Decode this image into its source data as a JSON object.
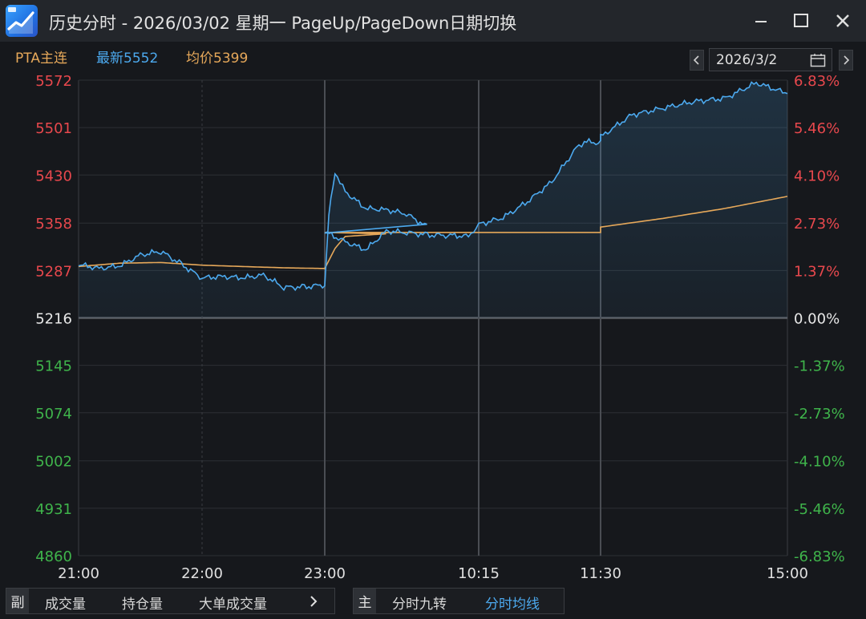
{
  "window": {
    "title": "历史分时 - 2026/03/02 星期一 PageUp/PageDown日期切换",
    "icon": "app-chart-icon"
  },
  "info": {
    "symbol": "PTA主连",
    "latest": "最新5552",
    "average": "均价5399",
    "date": "2026/3/2"
  },
  "colors": {
    "up": "#e8484d",
    "down": "#3fb44b",
    "price_line": "#4ca9ee",
    "avg_line": "#e6a85a",
    "grid": "#3a3d42"
  },
  "chart_data": {
    "type": "line",
    "base_price": 5216,
    "y_ticks_left": [
      "5572",
      "5501",
      "5430",
      "5358",
      "5287",
      "5216",
      "5145",
      "5074",
      "5002",
      "4931",
      "4860"
    ],
    "y_ticks_right": [
      "6.83%",
      "5.46%",
      "4.10%",
      "2.73%",
      "1.37%",
      "0.00%",
      "-1.37%",
      "-2.73%",
      "-4.10%",
      "-5.46%",
      "-6.83%"
    ],
    "ylim": [
      4860,
      5572
    ],
    "x_ticks": [
      "21:00",
      "22:00",
      "23:00",
      "10:15",
      "11:30",
      "15:00"
    ],
    "series": [
      {
        "name": "最新",
        "x": [
          "21:00",
          "21:10",
          "21:20",
          "21:30",
          "21:40",
          "21:50",
          "22:00",
          "22:10",
          "22:20",
          "22:30",
          "22:40",
          "22:50",
          "23:00",
          "23:02",
          "23:05",
          "23:10",
          "23:20",
          "23:30",
          "23:40",
          "23:50",
          "09:00",
          "09:10",
          "09:20",
          "09:30",
          "09:40",
          "09:50",
          "10:00",
          "10:10",
          "10:15",
          "10:30",
          "10:45",
          "11:00",
          "11:15",
          "11:20",
          "11:30",
          "13:30",
          "13:45",
          "14:00",
          "14:15",
          "14:30",
          "14:45",
          "15:00"
        ],
        "values": [
          5296,
          5290,
          5294,
          5310,
          5316,
          5296,
          5276,
          5278,
          5276,
          5280,
          5262,
          5262,
          5266,
          5370,
          5435,
          5405,
          5380,
          5378,
          5372,
          5352,
          5345,
          5330,
          5318,
          5346,
          5344,
          5340,
          5340,
          5338,
          5356,
          5366,
          5390,
          5420,
          5470,
          5480,
          5478,
          5487,
          5520,
          5530,
          5540,
          5545,
          5568,
          5552
        ]
      },
      {
        "name": "均价",
        "x": [
          "21:00",
          "21:20",
          "21:40",
          "22:00",
          "22:20",
          "22:40",
          "23:00",
          "23:05",
          "23:10",
          "23:30",
          "09:00",
          "10:00",
          "10:15",
          "11:00",
          "11:30",
          "13:30",
          "14:00",
          "14:30",
          "15:00"
        ],
        "values": [
          5293,
          5298,
          5299,
          5295,
          5293,
          5291,
          5290,
          5320,
          5338,
          5342,
          5344,
          5344,
          5344,
          5344,
          5344,
          5352,
          5365,
          5380,
          5398
        ]
      }
    ],
    "grid": true
  },
  "bottom": {
    "sub_label": "副",
    "sub_tabs": [
      "成交量",
      "持仓量",
      "大单成交量"
    ],
    "more_icon": "chevron-right-icon",
    "main_label": "主",
    "main_tabs": [
      "分时九转",
      "分时均线"
    ]
  }
}
